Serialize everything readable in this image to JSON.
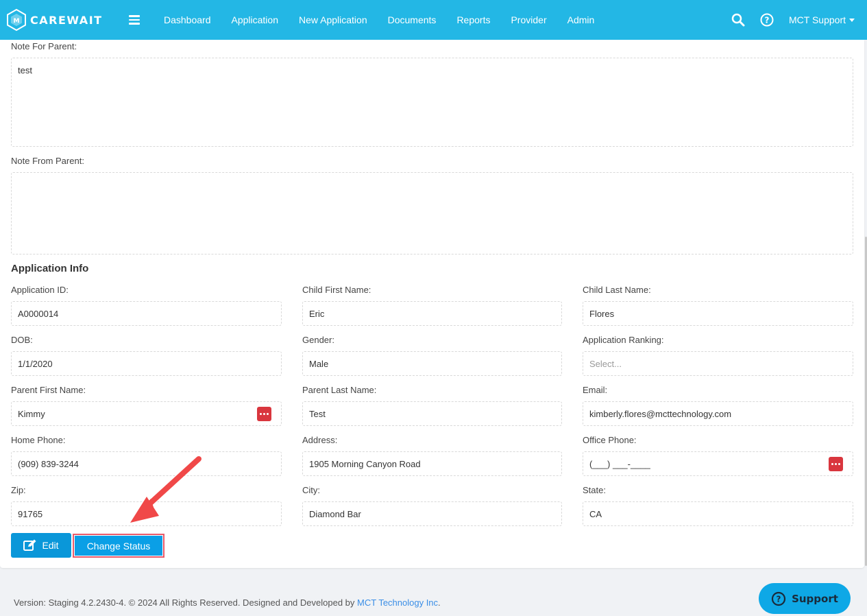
{
  "navbar": {
    "brand": "CAREWAIT",
    "links": [
      "Dashboard",
      "Application",
      "New Application",
      "Documents",
      "Reports",
      "Provider",
      "Admin"
    ],
    "user": "MCT Support",
    "icons": [
      "menu-icon",
      "search-icon",
      "help-icon",
      "caret-down-icon"
    ]
  },
  "notes": {
    "for_parent_label": "Note For Parent:",
    "for_parent_value": "test",
    "from_parent_label": "Note From Parent:",
    "from_parent_value": ""
  },
  "app_info": {
    "title": "Application Info",
    "fields": {
      "application_id": {
        "label": "Application ID:",
        "value": "A0000014"
      },
      "child_first_name": {
        "label": "Child First Name:",
        "value": "Eric"
      },
      "child_last_name": {
        "label": "Child Last Name:",
        "value": "Flores"
      },
      "dob": {
        "label": "DOB:",
        "value": "1/1/2020"
      },
      "gender": {
        "label": "Gender:",
        "value": "Male"
      },
      "application_ranking": {
        "label": "Application Ranking:",
        "placeholder": "Select..."
      },
      "parent_first_name": {
        "label": "Parent First Name:",
        "value": "Kimmy"
      },
      "parent_last_name": {
        "label": "Parent Last Name:",
        "value": "Test"
      },
      "email": {
        "label": "Email:",
        "value": "kimberly.flores@mcttechnology.com"
      },
      "home_phone": {
        "label": "Home Phone:",
        "value": "(909) 839-3244"
      },
      "address": {
        "label": "Address:",
        "value": "1905 Morning Canyon Road"
      },
      "office_phone": {
        "label": "Office Phone:",
        "value": "(___) ___-____"
      },
      "zip": {
        "label": "Zip:",
        "value": "91765"
      },
      "city": {
        "label": "City:",
        "value": "Diamond Bar"
      },
      "state": {
        "label": "State:",
        "value": "CA"
      }
    }
  },
  "actions": {
    "edit": "Edit",
    "change_status": "Change Status"
  },
  "footer": {
    "text": "Version: Staging 4.2.2430-4. © 2024 All Rights Reserved. Designed and Developed by ",
    "link": "MCT Technology Inc",
    "suffix": "."
  },
  "support": "Support",
  "colors": {
    "navbar": "#23b7e5",
    "primary_button": "#0a97d9",
    "highlight": "#e85a6a",
    "annotation_arrow": "#f04848",
    "dots_button": "#d9363e"
  }
}
